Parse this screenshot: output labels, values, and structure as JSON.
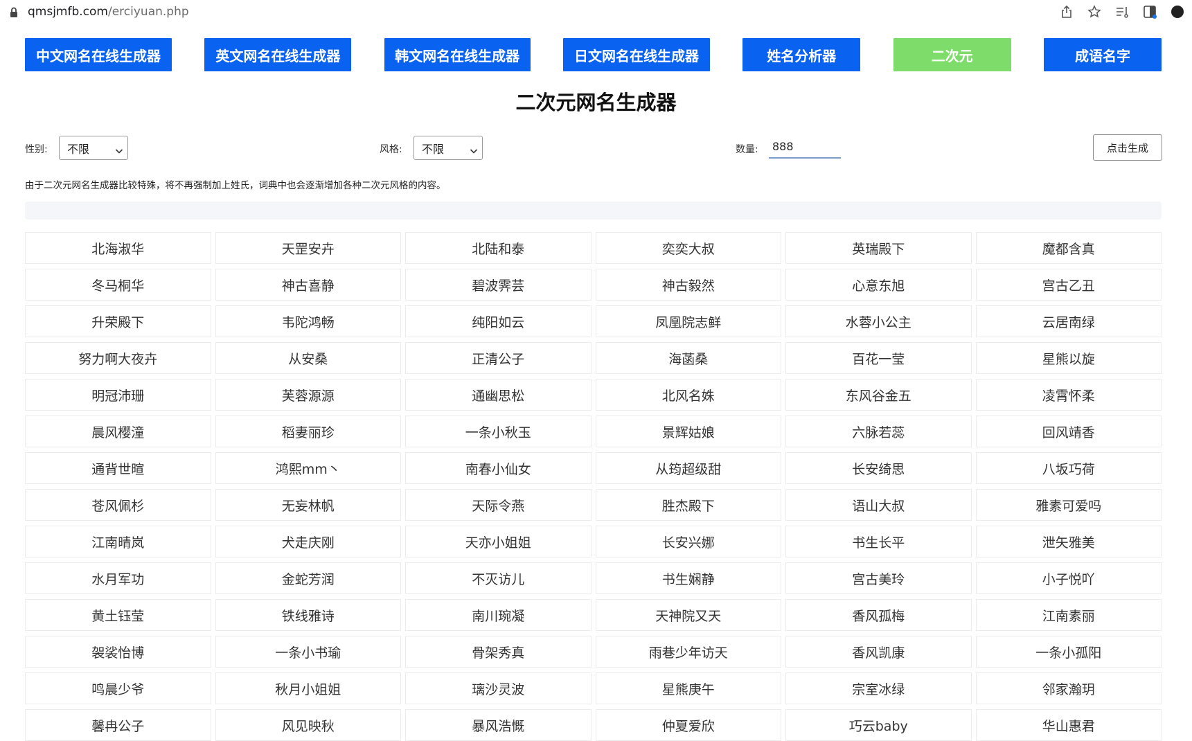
{
  "browser": {
    "url_host": "qmsjmfb.com",
    "url_path": "/erciyuan.php"
  },
  "nav": {
    "items": [
      {
        "label": "中文网名在线生成器"
      },
      {
        "label": "英文网名在线生成器"
      },
      {
        "label": "韩文网名在线生成器"
      },
      {
        "label": "日文网名在线生成器"
      },
      {
        "label": "姓名分析器"
      },
      {
        "label": "二次元"
      },
      {
        "label": "成语名字"
      }
    ],
    "active_index": 5,
    "color": "#0a62f0",
    "active_color": "#7ddc6a"
  },
  "page": {
    "title": "二次元网名生成器",
    "note": "由于二次元网名生成器比较特殊，将不再强制加上姓氏，词典中也会逐渐增加各种二次元风格的内容。"
  },
  "controls": {
    "gender_label": "性别:",
    "gender_value": "不限",
    "style_label": "风格:",
    "style_value": "不限",
    "count_label": "数量:",
    "count_value": "888",
    "generate_label": "点击生成"
  },
  "names": [
    [
      "北海淑华",
      "天罡安卉",
      "北陆和泰",
      "奕奕大叔",
      "英瑞殿下",
      "魔都含真"
    ],
    [
      "冬马桐华",
      "神古喜静",
      "碧波霁芸",
      "神古毅然",
      "心意东旭",
      "宫古乙丑"
    ],
    [
      "升荣殿下",
      "韦陀鸿畅",
      "纯阳如云",
      "凤凰院志鲜",
      "水蓉小公主",
      "云居南绿"
    ],
    [
      "努力啊大夜卉",
      "从安桑",
      "正清公子",
      "海菡桑",
      "百花一莹",
      "星熊以旋"
    ],
    [
      "明冠沛珊",
      "芙蓉源源",
      "通幽思松",
      "北风名姝",
      "东风谷金五",
      "凌霄怀柔"
    ],
    [
      "晨风樱潼",
      "稻妻丽珍",
      "一条小秋玉",
      "景辉姑娘",
      "六脉若蕊",
      "回风靖香"
    ],
    [
      "通背世暄",
      "鸿熙mm丶",
      "南春小仙女",
      "从筠超级甜",
      "长安绮思",
      "八坂巧荷"
    ],
    [
      "苍风佩杉",
      "无妄林帆",
      "天际令燕",
      "胜杰殿下",
      "语山大叔",
      "雅素可爱吗"
    ],
    [
      "江南晴岚",
      "犬走庆刚",
      "天亦小姐姐",
      "长安兴娜",
      "书生长平",
      "泄矢雅美"
    ],
    [
      "水月军功",
      "金蛇芳润",
      "不灭访儿",
      "书生娴静",
      "宫古美玲",
      "小子悦吖"
    ],
    [
      "黄土钰莹",
      "铁线雅诗",
      "南川琬凝",
      "天神院又天",
      "香风孤梅",
      "江南素丽"
    ],
    [
      "袈裟怡博",
      "一条小书瑜",
      "骨架秀真",
      "雨巷少年访天",
      "香风凯康",
      "一条小孤阳"
    ],
    [
      "鸣晨少爷",
      "秋月小姐姐",
      "璃沙灵波",
      "星熊庚午",
      "宗室冰绿",
      "邻家瀚玥"
    ],
    [
      "馨冉公子",
      "风见映秋",
      "暴风浩慨",
      "仲夏爱欣",
      "巧云baby",
      "华山惠君"
    ]
  ]
}
